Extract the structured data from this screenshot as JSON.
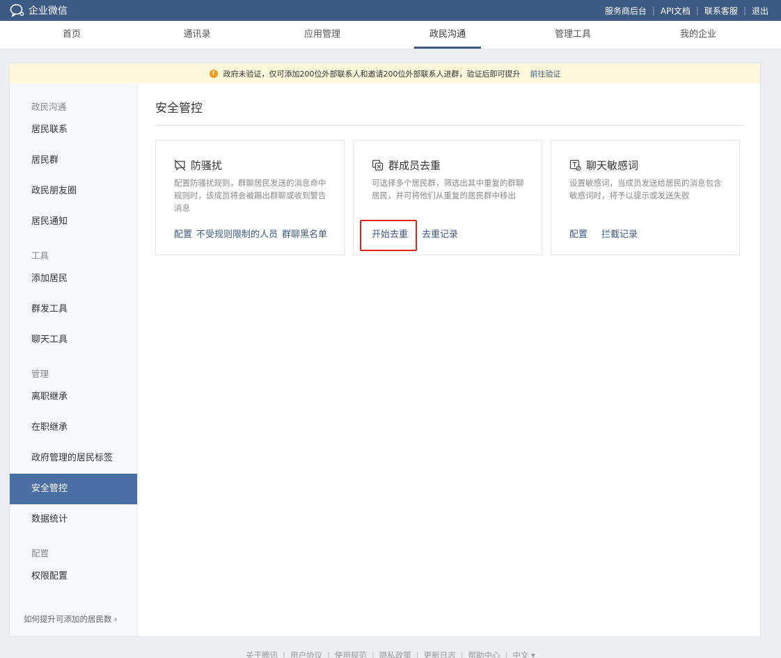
{
  "header": {
    "brand": "企业微信",
    "links": [
      "服务商后台",
      "API文档",
      "联系客服",
      "退出"
    ]
  },
  "nav": {
    "tabs": [
      "首页",
      "通讯录",
      "应用管理",
      "政民沟通",
      "管理工具",
      "我的企业"
    ],
    "active": "政民沟通"
  },
  "notice": {
    "text": "政府未验证，仅可添加200位外部联系人和邀请200位外部联系人进群，验证后即可提升",
    "link": "前往验证"
  },
  "sidebar": {
    "group1": "政民沟通",
    "items1": [
      "居民联系",
      "居民群",
      "政民朋友圈",
      "居民通知"
    ],
    "group2": "工具",
    "items2": [
      "添加居民",
      "群发工具",
      "聊天工具"
    ],
    "group3": "管理",
    "items3": [
      "离职继承",
      "在职继承",
      "政府管理的居民标签",
      "安全管控",
      "数据统计"
    ],
    "group4": "配置",
    "items4": [
      "权限配置"
    ],
    "active": "安全管控",
    "footer_link": "如何提升可添加的居民数"
  },
  "main": {
    "title": "安全管控",
    "cards": [
      {
        "title": "防骚扰",
        "icon": "anti-harassment-icon",
        "desc": "配置防骚扰规则，群聊居民发送的消息命中规则时，该成员将会被踢出群聊或收到警告消息",
        "actions": [
          "配置",
          "不受规则限制的人员",
          "群聊黑名单"
        ]
      },
      {
        "title": "群成员去重",
        "icon": "dedupe-icon",
        "desc": "可选择多个居民群，筛选出其中重复的群聊居民，并可将他们从重复的居民群中移出",
        "actions": [
          "开始去重",
          "去重记录"
        ]
      },
      {
        "title": "聊天敏感词",
        "icon": "sensitive-word-icon",
        "desc": "设置敏感词，当成员发送给居民的消息包含敏感词时，将予以提示或发送失败",
        "actions": [
          "配置",
          "拦截记录"
        ]
      }
    ]
  },
  "footer": {
    "links": [
      "关于腾讯",
      "用户协议",
      "使用规范",
      "隐私政策",
      "更新日志",
      "帮助中心",
      "中文 ▾"
    ]
  },
  "colors": {
    "header_bg": "#3d5a85",
    "active_sidebar": "#4a6fa2",
    "link": "#3d5a85",
    "notice_bg": "#fdf7dc",
    "highlight_border": "#e5221b"
  }
}
